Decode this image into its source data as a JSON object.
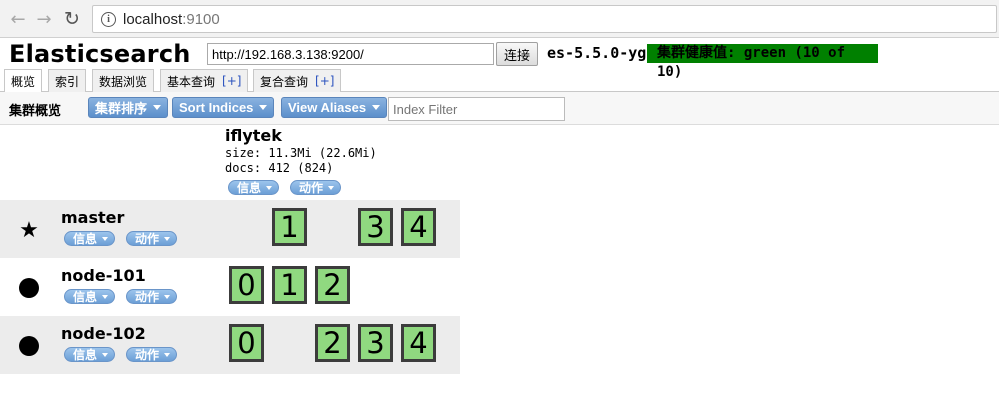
{
  "browser": {
    "url_host": "localhost",
    "url_port": ":9100"
  },
  "header": {
    "title": "Elasticsearch",
    "connection_url": "http://192.168.3.138:9200/",
    "connect_label": "连接",
    "cluster_name": "es-5.5.0-yg",
    "health_text": "集群健康值: green (10 of 10)",
    "health_color": "#008000"
  },
  "tabs": [
    {
      "label": "概览",
      "plus": ""
    },
    {
      "label": "索引",
      "plus": ""
    },
    {
      "label": "数据浏览",
      "plus": ""
    },
    {
      "label": "基本查询",
      "plus": "[+]"
    },
    {
      "label": "复合查询",
      "plus": "[+]"
    }
  ],
  "toolbar": {
    "title": "集群概览",
    "sort_cluster": "集群排序",
    "sort_indices": "Sort Indices",
    "view_aliases": "View Aliases",
    "filter_placeholder": "Index Filter"
  },
  "index": {
    "name": "iflytek",
    "size": "size: 11.3Mi (22.6Mi)",
    "docs": "docs: 412 (824)",
    "info_label": "信息",
    "action_label": "动作"
  },
  "nodes": [
    {
      "name": "master",
      "marker": "star-icon",
      "info_label": "信息",
      "action_label": "动作",
      "shards": [
        "1",
        "3",
        "4"
      ]
    },
    {
      "name": "node-101",
      "marker": "circle-icon",
      "info_label": "信息",
      "action_label": "动作",
      "shards": [
        "0",
        "1",
        "2"
      ]
    },
    {
      "name": "node-102",
      "marker": "circle-icon",
      "info_label": "信息",
      "action_label": "动作",
      "shards": [
        "0",
        "2",
        "3",
        "4"
      ]
    }
  ],
  "colors": {
    "shard_fill": "#90d980",
    "button_blue": "#5c8fcb",
    "row_shade": "#ececec"
  }
}
